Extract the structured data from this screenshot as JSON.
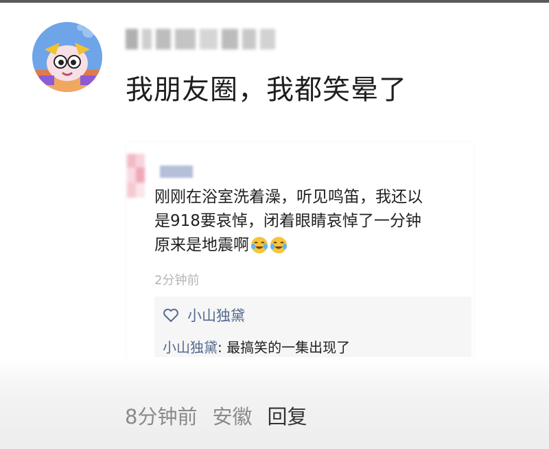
{
  "post": {
    "text": "我朋友圈，我都笑晕了"
  },
  "embedded_moment": {
    "lines": [
      "刚刚在浴室洗着澡，听见鸣笛，我还以",
      "是918要哀悼，闭着眼睛哀悼了一分钟",
      "原来是地震啊"
    ],
    "time": "2分钟前",
    "like_name": "小山独黛",
    "comment_author": "小山独黛",
    "comment_separator": ": ",
    "comment_text": "最搞笑的一集出现了",
    "emojis": [
      "laughing-crying-emoji",
      "laughing-crying-emoji"
    ]
  },
  "footer": {
    "time": "8分钟前",
    "location": "安徽",
    "reply": "回复"
  },
  "colors": {
    "link_blue": "#53688f",
    "text": "#1f1f1f",
    "muted": "#8a8a8a"
  }
}
